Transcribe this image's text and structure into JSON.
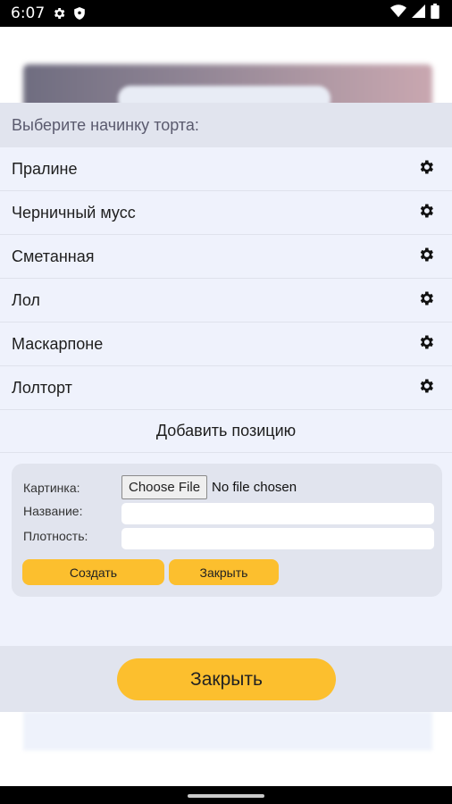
{
  "status_bar": {
    "time": "6:07",
    "left_icons": [
      "gear-icon",
      "shield-icon"
    ],
    "right_icons": [
      "wifi-icon",
      "signal-icon",
      "battery-icon"
    ]
  },
  "modal": {
    "header": "Выберите начинку торта:",
    "items": [
      {
        "label": "Пралине",
        "icon": "gear-icon"
      },
      {
        "label": "Черничный мусс",
        "icon": "gear-icon"
      },
      {
        "label": "Сметанная",
        "icon": "gear-icon"
      },
      {
        "label": "Лол",
        "icon": "gear-icon"
      },
      {
        "label": "Маскарпоне",
        "icon": "gear-icon"
      },
      {
        "label": "Лолторт",
        "icon": "gear-icon"
      }
    ],
    "add_position": "Добавить позицию",
    "form": {
      "image_label": "Картинка:",
      "choose_file": "Choose File",
      "file_status": "No file chosen",
      "name_label": "Название:",
      "name_value": "",
      "density_label": "Плотность:",
      "density_value": "",
      "create_button": "Создать",
      "close_button": "Закрыть"
    },
    "close_button": "Закрыть"
  },
  "colors": {
    "accent": "#fcbf2e",
    "modal_bg": "#eff2fc",
    "header_bg": "#e1e4ee"
  }
}
